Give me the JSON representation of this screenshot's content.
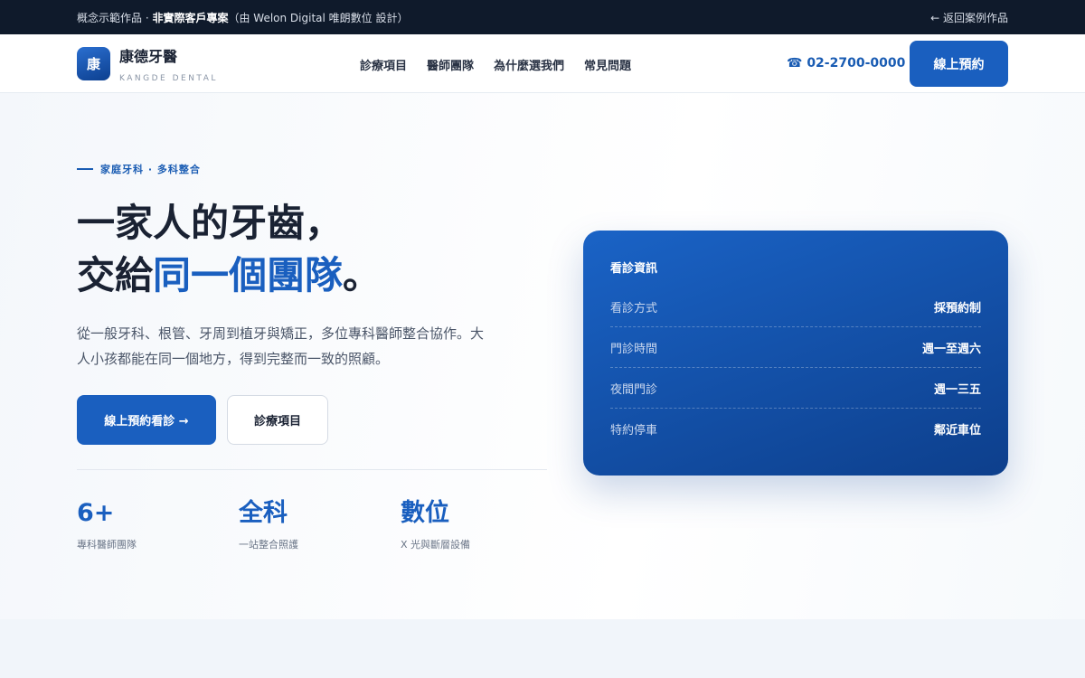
{
  "topbar": {
    "note_prefix": "概念示範作品 · ",
    "note_bold": "非實際客戶專案",
    "note_suffix": "（由 Welon Digital 唯朗數位 設計）",
    "back_label": "← 返回案例作品"
  },
  "header": {
    "logo_char": "康",
    "logo_name": "康德牙醫",
    "logo_sub": "KANGDE DENTAL",
    "nav": [
      "診療項目",
      "醫師團隊",
      "為什麼選我們",
      "常見問題"
    ],
    "phone": "☎ 02-2700-0000",
    "book_label": "線上預約"
  },
  "hero": {
    "eyebrow": "家庭牙科 · 多科整合",
    "headline_line1": "一家人的牙齒，",
    "headline_line2_prefix": "交給",
    "headline_line2_accent": "同一個團隊",
    "headline_line2_suffix": "。",
    "description": "從一般牙科、根管、牙周到植牙與矯正，多位專科醫師整合協作。大人小孩都能在同一個地方，得到完整而一致的照顧。",
    "primary_button": "線上預約看診 →",
    "secondary_button": "診療項目",
    "stats": [
      {
        "value": "6+",
        "label": "專科醫師團隊"
      },
      {
        "value": "全科",
        "label": "一站整合照護"
      },
      {
        "value": "數位",
        "label": "X 光與斷層設備"
      }
    ]
  },
  "info_card": {
    "title": "看診資訊",
    "rows": [
      {
        "key": "看診方式",
        "value": "採預約制"
      },
      {
        "key": "門診時間",
        "value": "週一至週六"
      },
      {
        "key": "夜間門診",
        "value": "週一三五"
      },
      {
        "key": "特約停車",
        "value": "鄰近車位"
      }
    ]
  },
  "colors": {
    "brand": "#1a5fbf",
    "topbar_bg": "#0f1a2b",
    "card_gradient_start": "#1a63c6",
    "card_gradient_end": "#0d3f8c"
  }
}
